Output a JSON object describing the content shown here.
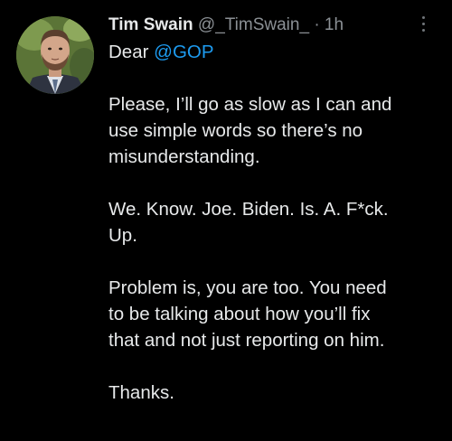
{
  "tweet": {
    "display_name": "Tim Swain",
    "handle": "@_TimSwain_",
    "separator": "·",
    "time": "1h",
    "greeting": "Dear",
    "mention": "@GOP",
    "paragraphs": [
      [
        "Please, I’ll go as slow as I can and",
        "use simple words so there’s no",
        "misunderstanding."
      ],
      [
        "We. Know. Joe. Biden. Is. A. F*ck.",
        "Up."
      ],
      [
        "Problem is, you are too. You need",
        "to be talking about how you’ll fix",
        "that and not just reporting on him."
      ],
      [
        "Thanks."
      ]
    ]
  },
  "colors": {
    "background": "#000000",
    "text": "#e7e9ea",
    "muted": "#8b9095",
    "link": "#1d9bf0"
  },
  "icons": {
    "more": "more-vertical-icon",
    "avatar": "profile-photo"
  }
}
